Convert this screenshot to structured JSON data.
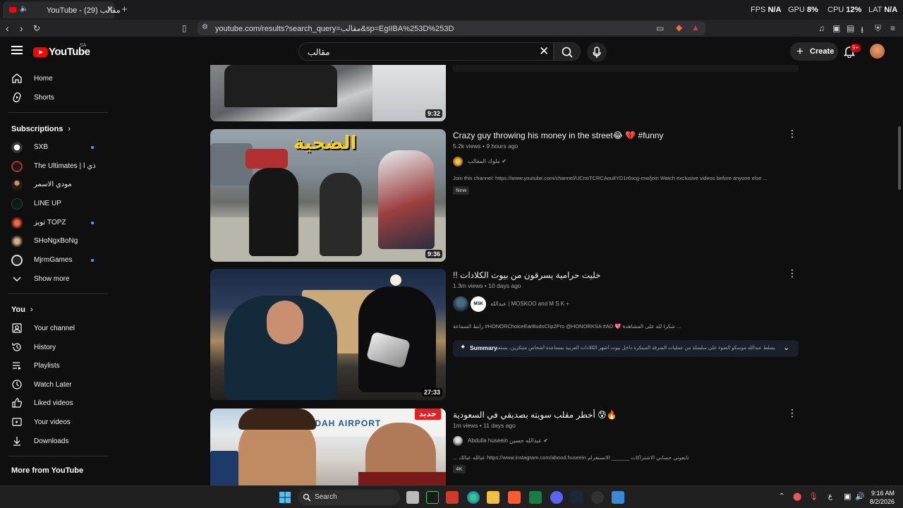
{
  "browser": {
    "tab_title": "YouTube - مقالب (29)",
    "url": "youtube.com/results?search_query=مقالب&sp=EgIIBA%253D%253D",
    "stats": [
      {
        "label": "FPS",
        "value": "N/A"
      },
      {
        "label": "GPU",
        "value": "8%"
      },
      {
        "label": "CPU",
        "value": "12%"
      },
      {
        "label": "LAT",
        "value": "N/A"
      }
    ]
  },
  "header": {
    "logo_text": "YouTube",
    "country_code": "SA",
    "search_query": "مقالب",
    "create_label": "Create",
    "notification_count": "9+"
  },
  "sidebar": {
    "main": [
      {
        "label": "Home",
        "icon": "home-icon"
      },
      {
        "label": "Shorts",
        "icon": "shorts-icon"
      }
    ],
    "subscriptions_title": "Subscriptions",
    "subscriptions": [
      {
        "label": "SXB",
        "new": true,
        "color": "#e8e8e8"
      },
      {
        "label": "The Ultimates | ذي ا",
        "new": false,
        "color": "#b33030"
      },
      {
        "label": "مودي الاسمر",
        "new": false,
        "color": "#5a3a2a"
      },
      {
        "label": "LINE UP",
        "new": false,
        "color": "#0a1a1a"
      },
      {
        "label": "توبز TOPZ",
        "new": true,
        "color": "#a02020"
      },
      {
        "label": "SHoNgxBoNg",
        "new": false,
        "color": "#8a6a4a"
      },
      {
        "label": "MjrmGames",
        "new": true,
        "color": "#333333"
      }
    ],
    "show_more": "Show more",
    "you_title": "You",
    "you": [
      {
        "label": "Your channel",
        "icon": "your-channel-icon"
      },
      {
        "label": "History",
        "icon": "history-icon"
      },
      {
        "label": "Playlists",
        "icon": "playlists-icon"
      },
      {
        "label": "Watch Later",
        "icon": "watch-later-icon"
      },
      {
        "label": "Liked videos",
        "icon": "liked-icon"
      },
      {
        "label": "Your videos",
        "icon": "your-videos-icon"
      },
      {
        "label": "Downloads",
        "icon": "downloads-icon"
      }
    ],
    "more_title": "More from YouTube"
  },
  "results": [
    {
      "duration": "9:32"
    },
    {
      "title": "Crazy guy throwing his money in the street😂 💔 #funny",
      "meta": "5.2k views • 9 hours ago",
      "channel": "ملوك المقالب",
      "desc": "Join this channel: https://www.youtube.com/channel/UCnoTCRCAoulIYD1r6scg-mw/join Watch exclusive videos before anyone else ...",
      "tag": "New",
      "duration": "9:36",
      "thumb_text": "الضحية"
    },
    {
      "title": "!! خليت حرامية يسرقون من بيوت الكلادات",
      "meta": "1.3m views • 10 days ago",
      "channel": "عبدالله | MOSKOO  and M S K +",
      "desc": "رابط السماعة #HONORChoiceEarBudsClip2Pro @HONORKSA #AD 💖 شكرا لله على المشاهدة ...",
      "summary_label": "Summary",
      "summary_text": "يسلط عبدالله موسكو الضوء على سلسلة من عمليات السرقة المبتكرة داخل بيوت أشهر الكلادات العربية بمساعدة أشخاص متنكرين، يستعرض المقطع التحديات التي",
      "duration": "27:33"
    },
    {
      "title": "أخطر مقلب سويته بصديقي في السعودية 😰🔥",
      "meta": "1m views • 11 days ago",
      "channel": "Abdulla huseein عبدالله حسين",
      "desc": "... عبالله عبالك https://www.instagram.com/abood.huseein تابعوني حسابي الاشتراكات ______ الانستغرام",
      "tag": "4K",
      "thumb_badge": "جديد",
      "thumb_sign": "JEDDAH AIRPORT"
    }
  ],
  "taskbar": {
    "search_label": "Search",
    "time": "9:16 AM",
    "date": "8/2/2026",
    "lang": "ع"
  }
}
